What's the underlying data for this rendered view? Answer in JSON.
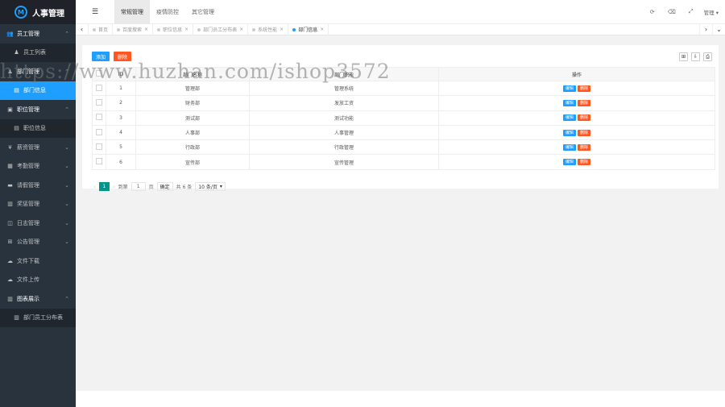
{
  "app": {
    "title": "人事管理",
    "logo_letter": "M"
  },
  "sidebar": {
    "items": [
      {
        "label": "员工管理",
        "icon": "user-group-icon",
        "glyph": "👥",
        "open": true,
        "children": [
          {
            "label": "员工列表",
            "icon": "user-icon",
            "glyph": "♟"
          }
        ]
      },
      {
        "label": "部门管理",
        "icon": "user-icon",
        "glyph": "♟",
        "open": true,
        "children": [
          {
            "label": "部门信息",
            "icon": "grid-icon",
            "glyph": "▤",
            "active": true
          }
        ]
      },
      {
        "label": "职位管理",
        "icon": "briefcase-icon",
        "glyph": "▣",
        "open": true,
        "children": [
          {
            "label": "职位信息",
            "icon": "grid-icon",
            "glyph": "▤"
          }
        ]
      },
      {
        "label": "薪资管理",
        "icon": "coin-icon",
        "glyph": "¥"
      },
      {
        "label": "考勤管理",
        "icon": "calendar-icon",
        "glyph": "▦"
      },
      {
        "label": "请假管理",
        "icon": "bed-icon",
        "glyph": "▬"
      },
      {
        "label": "奖惩管理",
        "icon": "gift-icon",
        "glyph": "▥"
      },
      {
        "label": "日志管理",
        "icon": "chat-icon",
        "glyph": "◫"
      },
      {
        "label": "公告管理",
        "icon": "grid-icon",
        "glyph": "⊞"
      },
      {
        "label": "文件下载",
        "icon": "cloud-download-icon",
        "glyph": "☁"
      },
      {
        "label": "文件上传",
        "icon": "cloud-upload-icon",
        "glyph": "☁"
      },
      {
        "label": "图表展示",
        "icon": "bar-chart-icon",
        "glyph": "▥",
        "open": true,
        "children": [
          {
            "label": "部门员工分布表",
            "icon": "bar-chart-icon",
            "glyph": "▥"
          }
        ]
      }
    ]
  },
  "header": {
    "menu_icon": "menu-icon",
    "tabs": [
      {
        "label": "常规管理",
        "active": true
      },
      {
        "label": "疫情防控"
      },
      {
        "label": "其它管理"
      }
    ],
    "right_icons": [
      {
        "name": "refresh-icon",
        "glyph": "⟳"
      },
      {
        "name": "trash-icon",
        "glyph": "🗑"
      },
      {
        "name": "fullscreen-icon",
        "glyph": "⤢"
      }
    ],
    "user_label": "管理 ▾"
  },
  "tabbar": {
    "tabs": [
      {
        "label": "首页",
        "closable": false
      },
      {
        "label": "百度搜索",
        "closable": true
      },
      {
        "label": "职位信息",
        "closable": true
      },
      {
        "label": "部门员工分布表",
        "closable": true
      },
      {
        "label": "系统性能",
        "closable": true
      },
      {
        "label": "部门信息",
        "closable": true,
        "active": true
      }
    ]
  },
  "toolbar": {
    "add_label": "添加",
    "delete_label": "删除"
  },
  "table": {
    "headers": [
      "",
      "ID",
      "部门名称",
      "部门职能",
      "操作"
    ],
    "rows": [
      {
        "id": "1",
        "name": "管理部",
        "func": "管理系统"
      },
      {
        "id": "2",
        "name": "财务部",
        "func": "发放工资"
      },
      {
        "id": "3",
        "name": "测试部",
        "func": "测试功能"
      },
      {
        "id": "4",
        "name": "人事部",
        "func": "人事管理"
      },
      {
        "id": "5",
        "name": "行政部",
        "func": "行政管理"
      },
      {
        "id": "6",
        "name": "宣传部",
        "func": "宣传管理"
      }
    ],
    "edit_label": "编辑",
    "delete_label": "删除"
  },
  "pager": {
    "current": "1",
    "goto_label": "到第",
    "page_value": "1",
    "page_unit": "页",
    "confirm_label": "确定",
    "total_label": "共 6 条",
    "per_page_label": "10 条/页"
  },
  "watermark": "https://www.huzhan.com/ishop3572"
}
